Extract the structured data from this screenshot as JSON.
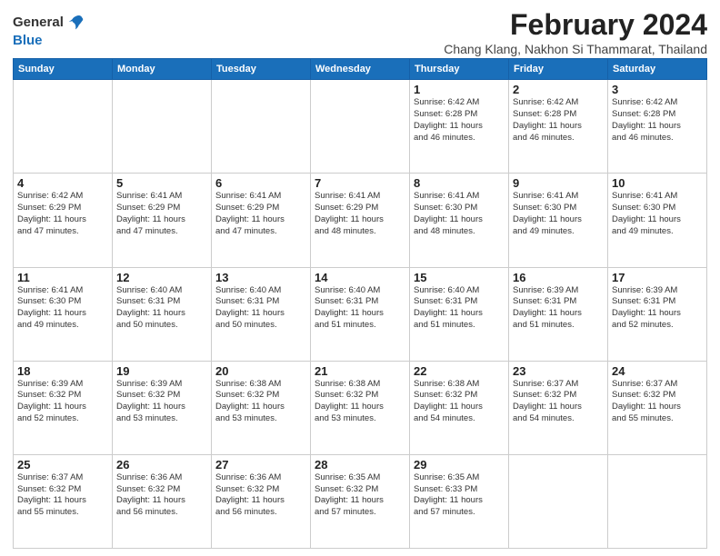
{
  "header": {
    "logo_line1": "General",
    "logo_line2": "Blue",
    "title": "February 2024",
    "subtitle": "Chang Klang, Nakhon Si Thammarat, Thailand"
  },
  "columns": [
    "Sunday",
    "Monday",
    "Tuesday",
    "Wednesday",
    "Thursday",
    "Friday",
    "Saturday"
  ],
  "weeks": [
    [
      {
        "day": "",
        "info": ""
      },
      {
        "day": "",
        "info": ""
      },
      {
        "day": "",
        "info": ""
      },
      {
        "day": "",
        "info": ""
      },
      {
        "day": "1",
        "info": "Sunrise: 6:42 AM\nSunset: 6:28 PM\nDaylight: 11 hours\nand 46 minutes."
      },
      {
        "day": "2",
        "info": "Sunrise: 6:42 AM\nSunset: 6:28 PM\nDaylight: 11 hours\nand 46 minutes."
      },
      {
        "day": "3",
        "info": "Sunrise: 6:42 AM\nSunset: 6:28 PM\nDaylight: 11 hours\nand 46 minutes."
      }
    ],
    [
      {
        "day": "4",
        "info": "Sunrise: 6:42 AM\nSunset: 6:29 PM\nDaylight: 11 hours\nand 47 minutes."
      },
      {
        "day": "5",
        "info": "Sunrise: 6:41 AM\nSunset: 6:29 PM\nDaylight: 11 hours\nand 47 minutes."
      },
      {
        "day": "6",
        "info": "Sunrise: 6:41 AM\nSunset: 6:29 PM\nDaylight: 11 hours\nand 47 minutes."
      },
      {
        "day": "7",
        "info": "Sunrise: 6:41 AM\nSunset: 6:29 PM\nDaylight: 11 hours\nand 48 minutes."
      },
      {
        "day": "8",
        "info": "Sunrise: 6:41 AM\nSunset: 6:30 PM\nDaylight: 11 hours\nand 48 minutes."
      },
      {
        "day": "9",
        "info": "Sunrise: 6:41 AM\nSunset: 6:30 PM\nDaylight: 11 hours\nand 49 minutes."
      },
      {
        "day": "10",
        "info": "Sunrise: 6:41 AM\nSunset: 6:30 PM\nDaylight: 11 hours\nand 49 minutes."
      }
    ],
    [
      {
        "day": "11",
        "info": "Sunrise: 6:41 AM\nSunset: 6:30 PM\nDaylight: 11 hours\nand 49 minutes."
      },
      {
        "day": "12",
        "info": "Sunrise: 6:40 AM\nSunset: 6:31 PM\nDaylight: 11 hours\nand 50 minutes."
      },
      {
        "day": "13",
        "info": "Sunrise: 6:40 AM\nSunset: 6:31 PM\nDaylight: 11 hours\nand 50 minutes."
      },
      {
        "day": "14",
        "info": "Sunrise: 6:40 AM\nSunset: 6:31 PM\nDaylight: 11 hours\nand 51 minutes."
      },
      {
        "day": "15",
        "info": "Sunrise: 6:40 AM\nSunset: 6:31 PM\nDaylight: 11 hours\nand 51 minutes."
      },
      {
        "day": "16",
        "info": "Sunrise: 6:39 AM\nSunset: 6:31 PM\nDaylight: 11 hours\nand 51 minutes."
      },
      {
        "day": "17",
        "info": "Sunrise: 6:39 AM\nSunset: 6:31 PM\nDaylight: 11 hours\nand 52 minutes."
      }
    ],
    [
      {
        "day": "18",
        "info": "Sunrise: 6:39 AM\nSunset: 6:32 PM\nDaylight: 11 hours\nand 52 minutes."
      },
      {
        "day": "19",
        "info": "Sunrise: 6:39 AM\nSunset: 6:32 PM\nDaylight: 11 hours\nand 53 minutes."
      },
      {
        "day": "20",
        "info": "Sunrise: 6:38 AM\nSunset: 6:32 PM\nDaylight: 11 hours\nand 53 minutes."
      },
      {
        "day": "21",
        "info": "Sunrise: 6:38 AM\nSunset: 6:32 PM\nDaylight: 11 hours\nand 53 minutes."
      },
      {
        "day": "22",
        "info": "Sunrise: 6:38 AM\nSunset: 6:32 PM\nDaylight: 11 hours\nand 54 minutes."
      },
      {
        "day": "23",
        "info": "Sunrise: 6:37 AM\nSunset: 6:32 PM\nDaylight: 11 hours\nand 54 minutes."
      },
      {
        "day": "24",
        "info": "Sunrise: 6:37 AM\nSunset: 6:32 PM\nDaylight: 11 hours\nand 55 minutes."
      }
    ],
    [
      {
        "day": "25",
        "info": "Sunrise: 6:37 AM\nSunset: 6:32 PM\nDaylight: 11 hours\nand 55 minutes."
      },
      {
        "day": "26",
        "info": "Sunrise: 6:36 AM\nSunset: 6:32 PM\nDaylight: 11 hours\nand 56 minutes."
      },
      {
        "day": "27",
        "info": "Sunrise: 6:36 AM\nSunset: 6:32 PM\nDaylight: 11 hours\nand 56 minutes."
      },
      {
        "day": "28",
        "info": "Sunrise: 6:35 AM\nSunset: 6:32 PM\nDaylight: 11 hours\nand 57 minutes."
      },
      {
        "day": "29",
        "info": "Sunrise: 6:35 AM\nSunset: 6:33 PM\nDaylight: 11 hours\nand 57 minutes."
      },
      {
        "day": "",
        "info": ""
      },
      {
        "day": "",
        "info": ""
      }
    ]
  ]
}
